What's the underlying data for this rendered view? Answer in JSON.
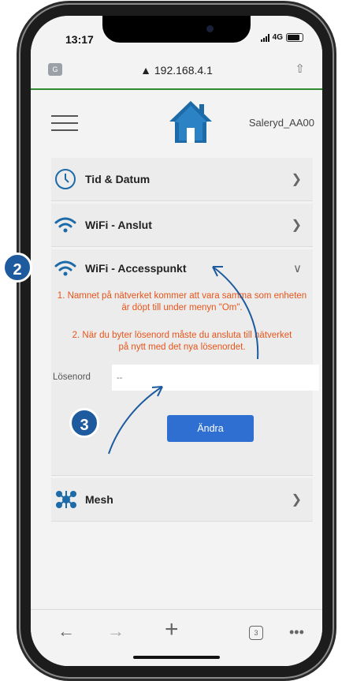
{
  "status": {
    "time": "13:17",
    "network": "4G"
  },
  "browser": {
    "url": "192.168.4.1"
  },
  "header": {
    "device_name": "Saleryd_AA00"
  },
  "menu": {
    "time_date": "Tid & Datum",
    "wifi_connect": "WiFi - Anslut",
    "wifi_ap": "WiFi - Accesspunkt",
    "mesh": "Mesh"
  },
  "ap_panel": {
    "note1": "1. Namnet på nätverket kommer att vara samma som enheten är döpt till under menyn \"Om\".",
    "note2": "2. När du byter lösenord måste du ansluta till nätverket på nytt med det nya lösenordet.",
    "password_label": "Lösenord",
    "password_placeholder": "--",
    "change_button": "Ändra"
  },
  "toolbar": {
    "tab_count": "3"
  },
  "callouts": {
    "step2": "2",
    "step3": "3"
  },
  "colors": {
    "accent": "#2f6fd1",
    "warning_text": "#e8541a",
    "badge": "#1e5a9e",
    "url_underline": "#2e8b2e"
  }
}
